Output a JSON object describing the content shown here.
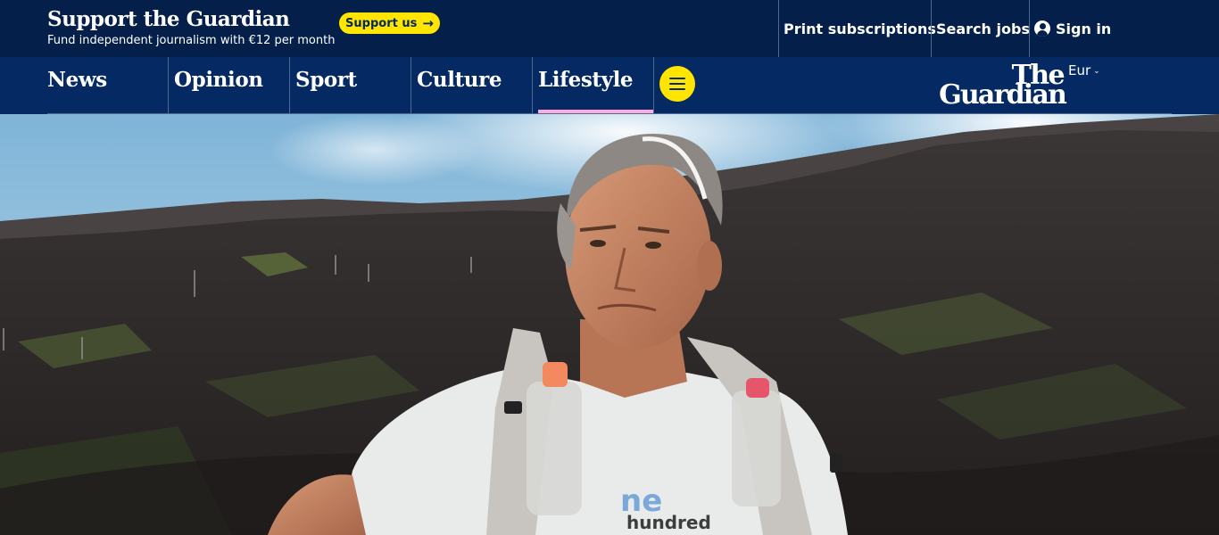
{
  "support": {
    "title": "Support the Guardian",
    "subtitle": "Fund independent journalism with €12 per month",
    "button_label": "Support us",
    "button_arrow": "→"
  },
  "top_links": {
    "print": "Print subscriptions",
    "jobs": "Search jobs",
    "signin": "Sign in"
  },
  "nav": {
    "pillars": [
      {
        "label": "News"
      },
      {
        "label": "Opinion"
      },
      {
        "label": "Sport"
      },
      {
        "label": "Culture"
      },
      {
        "label": "Lifestyle",
        "active": true
      }
    ],
    "active_color": "#ffabdb"
  },
  "logo": {
    "line1": "The",
    "line2": "Guardian"
  },
  "edition": {
    "label": "Eur",
    "chevron": "⌄"
  },
  "hero": {
    "shirt_text_line1": "ne",
    "shirt_text_line2": "hundred"
  },
  "colors": {
    "brand_dark": "#041f4a",
    "brand": "#052962",
    "yellow": "#ffe500",
    "lifestyle_pink": "#ffabdb"
  }
}
